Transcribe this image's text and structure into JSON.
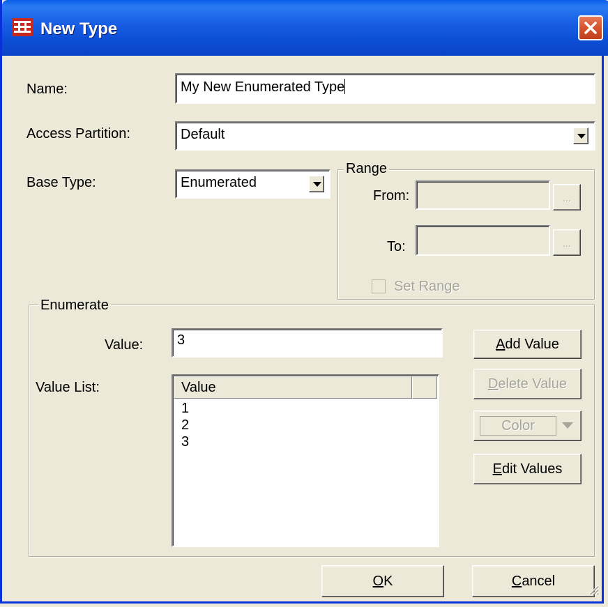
{
  "window": {
    "title": "New Type",
    "icon": "app-grid-icon",
    "close_icon": "close-icon"
  },
  "form": {
    "name_label": "Name:",
    "name_value": "My New Enumerated Type",
    "access_partition_label": "Access Partition:",
    "access_partition_value": "Default",
    "base_type_label": "Base Type:",
    "base_type_value": "Enumerated"
  },
  "range": {
    "legend": "Range",
    "from_label": "From:",
    "to_label": "To:",
    "browse_label": "...",
    "set_range_label": "Set Range"
  },
  "enumerate": {
    "legend": "Enumerate",
    "value_label": "Value:",
    "value_input": "3",
    "value_list_label": "Value List:",
    "column_header": "Value",
    "items": [
      "1",
      "2",
      "3"
    ]
  },
  "buttons": {
    "add_value": {
      "mnemonic": "A",
      "rest": "dd Value"
    },
    "delete_value": {
      "mnemonic": "D",
      "rest": "elete Value"
    },
    "color": "Color",
    "edit_values": {
      "mnemonic": "E",
      "rest": "dit Values"
    },
    "ok": {
      "mnemonic": "O",
      "rest": "K"
    },
    "cancel": {
      "mnemonic": "C",
      "rest": "ancel"
    }
  },
  "colors": {
    "titlebar": "#0c4fd6",
    "dialog_bg": "#ece9d8",
    "disabled_text": "#a7a59a"
  }
}
